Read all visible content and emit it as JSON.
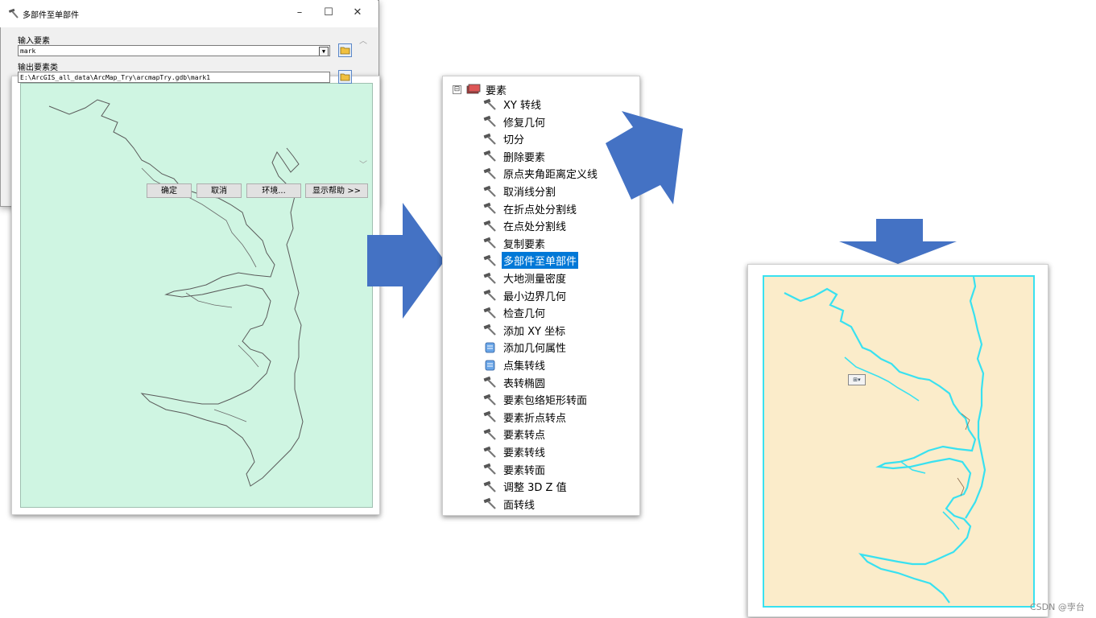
{
  "tree": {
    "root_label": "要素",
    "expander": "⊟",
    "items": [
      {
        "label": "XY 转线",
        "icon": "hammer-icon"
      },
      {
        "label": "修复几何",
        "icon": "hammer-icon"
      },
      {
        "label": "切分",
        "icon": "hammer-icon"
      },
      {
        "label": "删除要素",
        "icon": "hammer-icon"
      },
      {
        "label": "原点夹角距离定义线",
        "icon": "hammer-icon"
      },
      {
        "label": "取消线分割",
        "icon": "hammer-icon"
      },
      {
        "label": "在折点处分割线",
        "icon": "hammer-icon"
      },
      {
        "label": "在点处分割线",
        "icon": "hammer-icon"
      },
      {
        "label": "复制要素",
        "icon": "hammer-icon"
      },
      {
        "label": "多部件至单部件",
        "icon": "hammer-icon",
        "selected": true
      },
      {
        "label": "大地测量密度",
        "icon": "hammer-icon"
      },
      {
        "label": "最小边界几何",
        "icon": "hammer-icon"
      },
      {
        "label": "检查几何",
        "icon": "hammer-icon"
      },
      {
        "label": "添加 XY 坐标",
        "icon": "hammer-icon"
      },
      {
        "label": "添加几何属性",
        "icon": "script-icon"
      },
      {
        "label": "点集转线",
        "icon": "script-icon"
      },
      {
        "label": "表转椭圆",
        "icon": "hammer-icon"
      },
      {
        "label": "要素包络矩形转面",
        "icon": "hammer-icon"
      },
      {
        "label": "要素折点转点",
        "icon": "hammer-icon"
      },
      {
        "label": "要素转点",
        "icon": "hammer-icon"
      },
      {
        "label": "要素转线",
        "icon": "hammer-icon"
      },
      {
        "label": "要素转面",
        "icon": "hammer-icon"
      },
      {
        "label": "调整 3D Z 值",
        "icon": "hammer-icon"
      },
      {
        "label": "面转线",
        "icon": "hammer-icon"
      }
    ]
  },
  "dialog": {
    "title": "多部件至单部件",
    "minimize": "–",
    "maximize": "☐",
    "close": "✕",
    "input_label": "输入要素",
    "input_value": "mark",
    "output_label": "输出要素类",
    "output_value": "E:\\ArcGIS_all_data\\ArcMap_Try\\arcmapTry.gdb\\mark1",
    "buttons": {
      "ok": "确定",
      "cancel": "取消",
      "env": "环境...",
      "help": "显示帮助 >>"
    }
  },
  "map_right": {
    "info_label": "⊞▾"
  },
  "credit": "CSDN @孛台",
  "colors": {
    "arrow": "#4472c4",
    "left_paper": "#cff5e2",
    "right_paper": "#fbecca",
    "river_cyan": "#39e1f0",
    "selection": "#0078d7"
  }
}
